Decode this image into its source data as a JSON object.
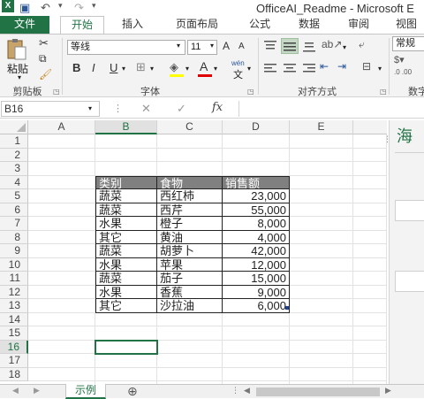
{
  "titlebar": {
    "title": "OfficeAI_Readme - Microsoft E",
    "excel_icon": "excel-icon",
    "save_icon": "save-icon",
    "undo_icon": "undo-icon",
    "redo_icon": "redo-icon"
  },
  "tabs": [
    {
      "label": "文件"
    },
    {
      "label": "开始"
    },
    {
      "label": "插入"
    },
    {
      "label": "页面布局"
    },
    {
      "label": "公式"
    },
    {
      "label": "数据"
    },
    {
      "label": "审阅"
    },
    {
      "label": "视图"
    }
  ],
  "ribbon": {
    "clipboard": {
      "paste_label": "粘贴",
      "group_label": "剪贴板"
    },
    "font": {
      "font_name": "等线",
      "font_size": "11",
      "bold": "B",
      "italic": "I",
      "underline": "U",
      "grow": "A",
      "shrink": "A",
      "font_color_letter": "A",
      "wen": "wén",
      "group_label": "字体"
    },
    "alignment": {
      "group_label": "对齐方式"
    },
    "number": {
      "format": "常规",
      "group_label": "数字"
    }
  },
  "formula_bar": {
    "name_box": "B16",
    "fx": "fx",
    "cancel": "✕",
    "enter": "✓",
    "formula": ""
  },
  "columns": [
    "A",
    "B",
    "C",
    "D",
    "E"
  ],
  "selected_column": "B",
  "rows": [
    "1",
    "2",
    "3",
    "4",
    "5",
    "6",
    "7",
    "8",
    "9",
    "10",
    "11",
    "12",
    "13",
    "14",
    "15",
    "16",
    "17",
    "18"
  ],
  "selected_row": "16",
  "table": {
    "headers": [
      "类别",
      "食物",
      "销售额"
    ],
    "rows": [
      [
        "蔬菜",
        "西红柿",
        "23,000"
      ],
      [
        "蔬菜",
        "西芹",
        "55,000"
      ],
      [
        "水果",
        "橙子",
        "8,000"
      ],
      [
        "其它",
        "黄油",
        "4,000"
      ],
      [
        "蔬菜",
        "胡萝卜",
        "42,000"
      ],
      [
        "水果",
        "苹果",
        "12,000"
      ],
      [
        "蔬菜",
        "茄子",
        "15,000"
      ],
      [
        "水果",
        "香蕉",
        "9,000"
      ],
      [
        "其它",
        "沙拉油",
        "6,000"
      ]
    ]
  },
  "sheet": {
    "tab_label": "示例",
    "add_icon": "add-sheet-icon"
  },
  "side_pane": {
    "title_char": "海"
  },
  "colors": {
    "accent": "#217346",
    "header_fill": "#808080"
  }
}
